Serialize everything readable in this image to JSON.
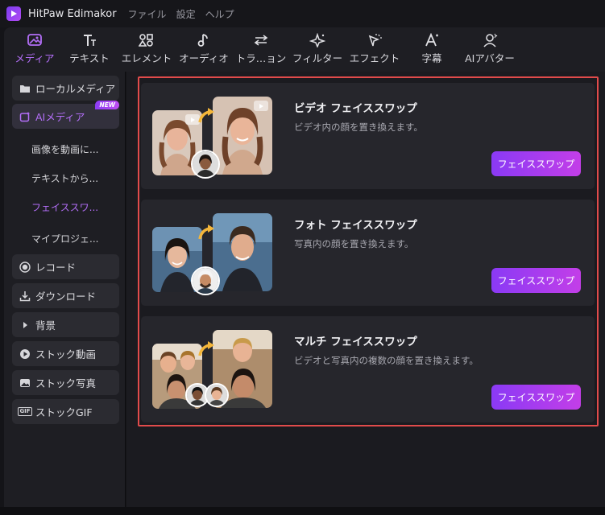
{
  "app": {
    "title": "HitPaw Edimakor",
    "menu": [
      "ファイル",
      "設定",
      "ヘルプ"
    ]
  },
  "toolbar": {
    "tabs": [
      {
        "label": "メディア",
        "icon": "media-icon",
        "active": true
      },
      {
        "label": "テキスト",
        "icon": "text-icon",
        "active": false
      },
      {
        "label": "エレメント",
        "icon": "element-icon",
        "active": false
      },
      {
        "label": "オーディオ",
        "icon": "audio-icon",
        "active": false
      },
      {
        "label": "トラ…ョン",
        "icon": "transition-icon",
        "active": false
      },
      {
        "label": "フィルター",
        "icon": "filter-icon",
        "active": false
      },
      {
        "label": "エフェクト",
        "icon": "effect-icon",
        "active": false
      },
      {
        "label": "字幕",
        "icon": "subtitle-icon",
        "active": false
      },
      {
        "label": "AIアバター",
        "icon": "ai-avatar-icon",
        "active": false
      }
    ]
  },
  "sidebar": {
    "local_media": "ローカルメディア",
    "ai_media": "AIメディア",
    "new_badge": "NEW",
    "sub_items": [
      "画像を動画に...",
      "テキストから...",
      "フェイススワ...",
      "マイプロジェ..."
    ],
    "active_sub": "フェイススワ...",
    "record": "レコード",
    "download": "ダウンロード",
    "background": "背景",
    "stock_video": "ストック動画",
    "stock_photo": "ストック写真",
    "stock_gif": "ストックGIF",
    "gif_badge": "GIF"
  },
  "cards": [
    {
      "title": "ビデオ フェイススワップ",
      "desc": "ビデオ内の顔を置き換えます。",
      "button": "フェイススワップ"
    },
    {
      "title": "フォト フェイススワップ",
      "desc": "写真内の顔を置き換えます。",
      "button": "フェイススワップ"
    },
    {
      "title": "マルチ フェイススワップ",
      "desc": "ビデオと写真内の複数の顔を置き換えます。",
      "button": "フェイススワップ"
    }
  ],
  "colors": {
    "accent": "#b36ef7",
    "button_gradient_start": "#8a3af5",
    "button_gradient_end": "#c33ee8",
    "highlight_border": "#e14b4b"
  }
}
